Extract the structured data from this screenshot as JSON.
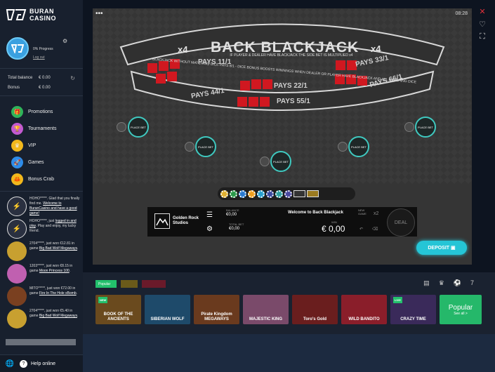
{
  "brand": {
    "line1": "BURAN",
    "line2": "CASINO"
  },
  "profile": {
    "progress": "0% Progress",
    "logout": "Log out"
  },
  "balances": {
    "total_label": "Total balance",
    "total_value": "€ 0.00",
    "bonus_label": "Bonus",
    "bonus_value": "€ 0.00"
  },
  "menu": [
    {
      "label": "Promotions",
      "color": "#2fb35a",
      "icon": "gift-icon"
    },
    {
      "label": "Tournaments",
      "color": "#c35ad0",
      "icon": "trophy-icon"
    },
    {
      "label": "VIP",
      "color": "#f2b81c",
      "icon": "crown-icon"
    },
    {
      "label": "Games",
      "color": "#2e8ce8",
      "icon": "rocket-icon"
    },
    {
      "label": "Bonus Crab",
      "color": "#f2b81c",
      "icon": "crab-icon"
    }
  ],
  "feed": [
    {
      "pre": "HOHO*****. Glad that you finally find me. ",
      "link": "Welcome to BuranCasino and have a good game!",
      "post": ""
    },
    {
      "pre": "HOHO*****, just ",
      "link": "logged in and play",
      "post": ". Play and enjoy, my lucky friend."
    },
    {
      "pre": "2704*****, just won €12.81 in game ",
      "link": "Big Bad Wolf Megaways",
      "post": "."
    },
    {
      "pre": "1203*****, just won €8.15 in game ",
      "link": "Moon Princess 100",
      "post": "."
    },
    {
      "pre": "MITO*****, just won €72.00 in game ",
      "link": "Fire In The Hole xBomb",
      "post": "."
    },
    {
      "pre": "2704*****, just won €5.40 in game ",
      "link": "Big Bad Wolf Megaways",
      "post": "."
    }
  ],
  "help": "Help online",
  "game": {
    "timer": "08:28",
    "title": "BACK BLACKJACK",
    "mult_left": "x4",
    "mult_right": "x4",
    "ribbon_top": "IF PLAYER & DEALER HAVE BLACKJACK THE SIDE BET IS MULTIPLIED x4",
    "ribbon_bottom": "BLACKJACK WITHOUT MATCHING DICE PAYS 8/1 - DICE BONUS BOOSTS WINNINGS WHEN DEALER OR PLAYER HAVE BLACKJACK AND ALL MATCHING DICE",
    "pays": [
      "PAYS 11/1",
      "PAYS 22/1",
      "PAYS 33/1",
      "PAYS 44/1",
      "PAYS 55/1",
      "PAYS 66/1"
    ],
    "place_bet": "PLACE BET",
    "provider": "Golden Rock Studios",
    "balance_label": "BALANCE",
    "balance_value": "€0,00",
    "total_bet_label": "TOTAL BET",
    "total_bet_value": "€0,00",
    "welcome": "Welcome to Back Blackjack",
    "win_label": "WIN",
    "win_value": "€ 0,00",
    "new_game_label": "NEW GAME",
    "x2": "x2",
    "deal": "DEAL",
    "deposit": "DEPOSIT"
  },
  "tabs": [
    "Popular",
    "",
    ""
  ],
  "thumbs": [
    {
      "title": "BOOK OF THE ANCIENTS",
      "tag": "NEW",
      "bg": "#6a4a1e"
    },
    {
      "title": "SIBERIAN WOLF",
      "tag": "",
      "bg": "#1e4a6a"
    },
    {
      "title": "Pirate Kingdom MEGAWAYS",
      "tag": "",
      "bg": "#6a3a1e"
    },
    {
      "title": "MAJESTIC KING",
      "tag": "",
      "bg": "#7a4a6a"
    },
    {
      "title": "Toro's Gold",
      "tag": "",
      "bg": "#6a1e1e"
    },
    {
      "title": "WILD BANDITO",
      "tag": "",
      "bg": "#8a1e2a"
    },
    {
      "title": "CRAZY TIME",
      "tag": "LIVE",
      "bg": "#3a2a5a"
    }
  ],
  "popular_card": {
    "title": "Popular",
    "sub": "See all >"
  }
}
